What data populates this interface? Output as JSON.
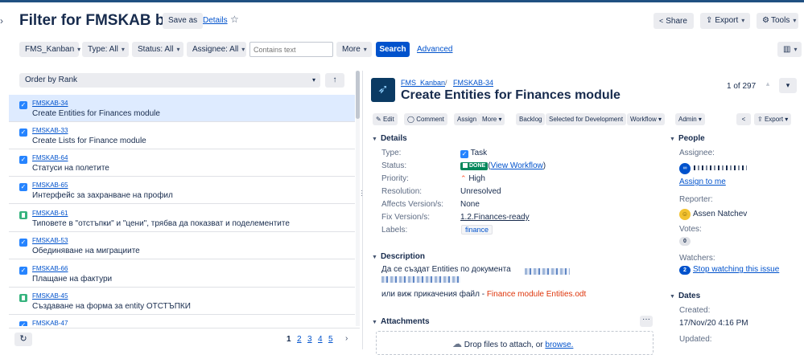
{
  "header": {
    "title": "Filter for FMSKAB board",
    "save_as": "Save as",
    "details": "Details",
    "share": "Share",
    "export": "Export",
    "tools": "Tools"
  },
  "filters": {
    "project": "FMS_Kanban",
    "type": "Type: All",
    "status": "Status: All",
    "assignee": "Assignee: All",
    "text_placeholder": "Contains text",
    "more": "More",
    "search": "Search",
    "advanced": "Advanced"
  },
  "list": {
    "order_by": "Order by Rank",
    "items": [
      {
        "key": "FMSKAB-34",
        "summary": "Create Entities for Finances module",
        "type": "task"
      },
      {
        "key": "FMSKAB-33",
        "summary": "Create Lists for Finance module",
        "type": "task"
      },
      {
        "key": "FMSKAB-64",
        "summary": "Статуси на полетите",
        "type": "task"
      },
      {
        "key": "FMSKAB-65",
        "summary": "Интерфейс за захранване на профил",
        "type": "task"
      },
      {
        "key": "FMSKAB-61",
        "summary": "Типовете в \"отстъпки\" и \"цени\", трябва да показват и поделементите",
        "type": "story"
      },
      {
        "key": "FMSKAB-53",
        "summary": "Обединяване на миграциите",
        "type": "task"
      },
      {
        "key": "FMSKAB-66",
        "summary": "Плащане на фактури",
        "type": "task"
      },
      {
        "key": "FMSKAB-45",
        "summary": "Създаване на форма за entity ОТСТЪПКИ",
        "type": "story"
      },
      {
        "key": "FMSKAB-47",
        "summary": "",
        "type": "task"
      }
    ],
    "pagination": [
      "1",
      "2",
      "3",
      "4",
      "5"
    ]
  },
  "issue": {
    "project_link": "FMS_Kanban",
    "key": "FMSKAB-34",
    "title": "Create Entities for Finances module",
    "counter": "1 of 297",
    "toolbar": {
      "edit": "Edit",
      "comment": "Comment",
      "assign": "Assign",
      "more": "More",
      "backlog": "Backlog",
      "selected": "Selected for Development",
      "workflow": "Workflow",
      "admin": "Admin",
      "export": "Export"
    },
    "details": {
      "heading": "Details",
      "type_label": "Type:",
      "type_value": "Task",
      "status_label": "Status:",
      "status_badge": "DONE",
      "status_open": "(",
      "status_link": "View Workflow",
      "status_close": ")",
      "priority_label": "Priority:",
      "priority_value": "High",
      "resolution_label": "Resolution:",
      "resolution_value": "Unresolved",
      "affects_label": "Affects Version/s:",
      "affects_value": "None",
      "fix_label": "Fix Version/s:",
      "fix_value": "1.2.Finances-ready",
      "labels_label": "Labels:",
      "labels_value": "finance"
    },
    "description": {
      "heading": "Description",
      "line1": "Да се създат Entities по документа",
      "line2_prefix": "или виж прикачения файл - ",
      "line2_file": "Finance module Entities.odt"
    },
    "attachments": {
      "heading": "Attachments",
      "drop_text": "Drop files to attach, or ",
      "browse": "browse."
    },
    "people": {
      "heading": "People",
      "assignee_label": "Assignee:",
      "assign_to_me": "Assign to me",
      "reporter_label": "Reporter:",
      "reporter_name": "Assen Natchev",
      "votes_label": "Votes:",
      "votes_count": "0",
      "watchers_label": "Watchers:",
      "watchers_count": "2",
      "stop_watching": "Stop watching this issue"
    },
    "dates": {
      "heading": "Dates",
      "created_label": "Created:",
      "created_value": "17/Nov/20 4:16 PM",
      "updated_label": "Updated:"
    }
  },
  "colors": {
    "accent": "#0052cc",
    "search_button": "#0052cc",
    "done_badge": "#00875a",
    "selected_row": "#deebff",
    "priority_high": "#ff5630"
  }
}
